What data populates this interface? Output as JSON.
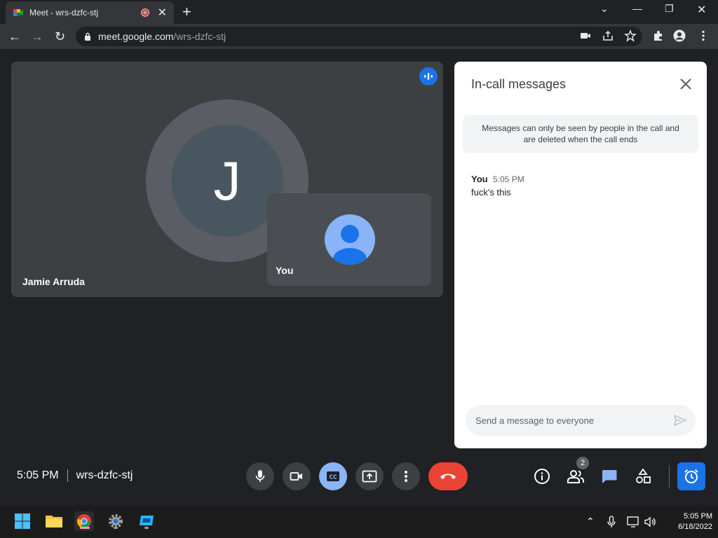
{
  "browser": {
    "tab_title": "Meet - wrs-dzfc-stj",
    "url_host": "meet.google.com",
    "url_path": "/wrs-dzfc-stj"
  },
  "stage": {
    "participant_initial": "J",
    "participant_name": "Jamie Arruda",
    "self_label": "You"
  },
  "chat": {
    "title": "In-call messages",
    "notice_line1": "Messages can only be seen by people in the call and",
    "notice_line2": "are deleted when the call ends",
    "messages": [
      {
        "sender": "You",
        "time": "5:05 PM",
        "text": "fuck's this"
      }
    ],
    "input_placeholder": "Send a message to everyone"
  },
  "bottom_bar": {
    "time": "5:05 PM",
    "meeting_code": "wrs-dzfc-stj",
    "people_count": "2"
  },
  "taskbar": {
    "time": "5:05 PM",
    "date": "6/18/2022"
  },
  "colors": {
    "accent_blue": "#1a73e8",
    "active_blue": "#8ab4f8",
    "end_call_red": "#ea4335",
    "dark_bg": "#202124"
  }
}
